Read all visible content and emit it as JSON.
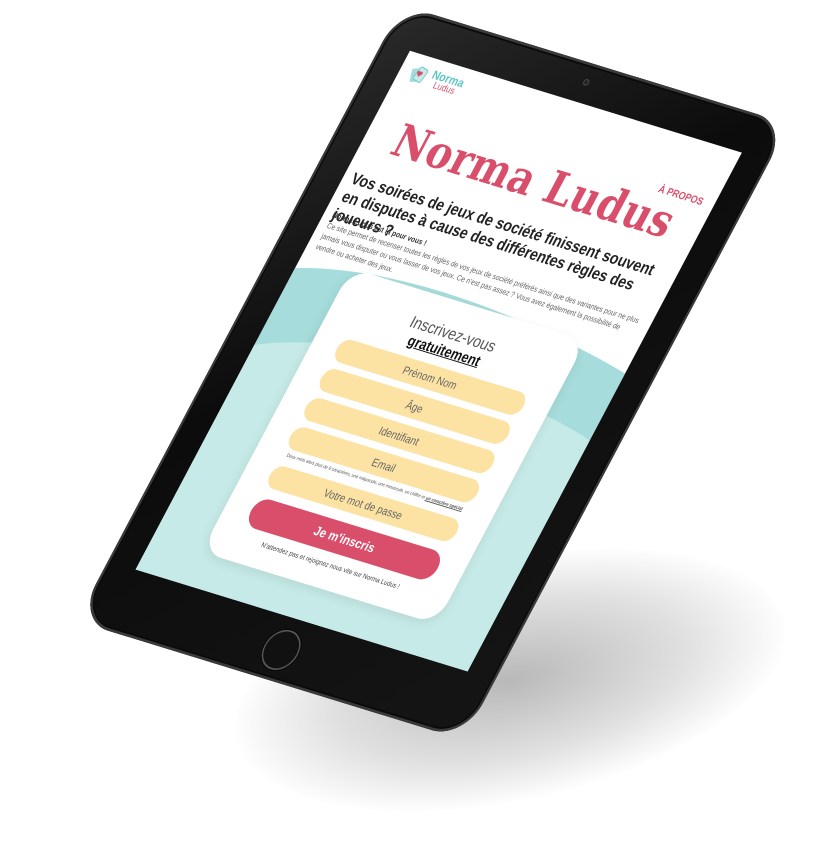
{
  "brand": {
    "logo_line1": "Norma",
    "logo_line2": "Ludus",
    "colors": {
      "primary": "#d94f6b",
      "teal": "#5fc5c6",
      "field": "#fde3a3",
      "wave": "#a6dcdb"
    }
  },
  "nav": {
    "about_label": "À PROPOS"
  },
  "hero": {
    "title": "Norma Ludus",
    "subtitle": "Vos soirées de jeux de société finissent souvent en disputes à cause des différentes règles des joueurs ?",
    "intro_lead": "Norma Ludus est là pour vous !",
    "intro_body": "Ce site permet de recenser toutes les règles de vos jeux de société préférés ainsi que des variantes pour ne plus jamais vous disputer ou vous lasser de vos jeux. Ce n'est pas assez ? Vous avez également la possibilité de vendre ou acheter des jeux."
  },
  "signup": {
    "title": "Inscrivez-vous",
    "title_strong": "gratuitement",
    "fields": {
      "name_placeholder": "Prénom Nom",
      "age_placeholder": "Âge",
      "identifier_placeholder": "Identifiant",
      "email_placeholder": "Email",
      "password_placeholder": "Votre mot de passe"
    },
    "hint_text": "Deux mots alors plus de 8 caractères, une majuscule, une minuscule, un chiffre et",
    "hint_link": "un caractère spécial",
    "submit_label": "Je m'inscris",
    "footer_note": "N'attendez pas et rejoignez nous vite sur Norma Ludus !"
  },
  "icons": {
    "logo": "cards-logo-icon"
  }
}
